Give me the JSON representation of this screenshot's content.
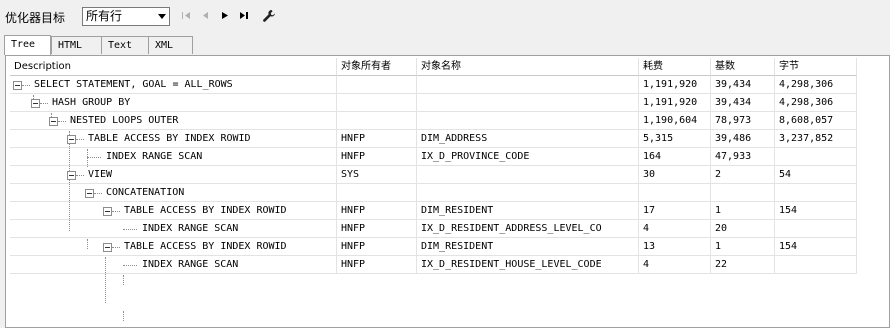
{
  "toolbar": {
    "goal_label": "优化器目标",
    "goal_value": "所有行",
    "icons": [
      "first-icon",
      "prev-icon",
      "next-icon",
      "last-icon",
      "wrench-icon"
    ]
  },
  "tabs": [
    {
      "label": "Tree",
      "active": true
    },
    {
      "label": "HTML",
      "active": false
    },
    {
      "label": "Text",
      "active": false
    },
    {
      "label": "XML",
      "active": false
    }
  ],
  "columns": [
    "Description",
    "对象所有者",
    "对象名称",
    "耗费",
    "基数",
    "字节"
  ],
  "rows": [
    {
      "desc": "SELECT STATEMENT, GOAL = ALL_ROWS",
      "owner": "",
      "name": "",
      "cost": "1,191,920",
      "card": "39,434",
      "bytes": "4,298,306"
    },
    {
      "desc": "HASH GROUP BY",
      "owner": "",
      "name": "",
      "cost": "1,191,920",
      "card": "39,434",
      "bytes": "4,298,306"
    },
    {
      "desc": "NESTED LOOPS OUTER",
      "owner": "",
      "name": "",
      "cost": "1,190,604",
      "card": "78,973",
      "bytes": "8,608,057"
    },
    {
      "desc": "TABLE ACCESS BY INDEX ROWID",
      "owner": "HNFP",
      "name": "DIM_ADDRESS",
      "cost": "5,315",
      "card": "39,486",
      "bytes": "3,237,852"
    },
    {
      "desc": "INDEX RANGE SCAN",
      "owner": "HNFP",
      "name": "IX_D_PROVINCE_CODE",
      "cost": "164",
      "card": "47,933",
      "bytes": ""
    },
    {
      "desc": "VIEW",
      "owner": "SYS",
      "name": "",
      "cost": "30",
      "card": "2",
      "bytes": "54"
    },
    {
      "desc": "CONCATENATION",
      "owner": "",
      "name": "",
      "cost": "",
      "card": "",
      "bytes": ""
    },
    {
      "desc": "TABLE ACCESS BY INDEX ROWID",
      "owner": "HNFP",
      "name": "DIM_RESIDENT",
      "cost": "17",
      "card": "1",
      "bytes": "154"
    },
    {
      "desc": "INDEX RANGE SCAN",
      "owner": "HNFP",
      "name": "IX_D_RESIDENT_ADDRESS_LEVEL_CO",
      "cost": "4",
      "card": "20",
      "bytes": ""
    },
    {
      "desc": "TABLE ACCESS BY INDEX ROWID",
      "owner": "HNFP",
      "name": "DIM_RESIDENT",
      "cost": "13",
      "card": "1",
      "bytes": "154"
    },
    {
      "desc": "INDEX RANGE SCAN",
      "owner": "HNFP",
      "name": "IX_D_RESIDENT_HOUSE_LEVEL_CODE",
      "cost": "4",
      "card": "22",
      "bytes": ""
    }
  ]
}
